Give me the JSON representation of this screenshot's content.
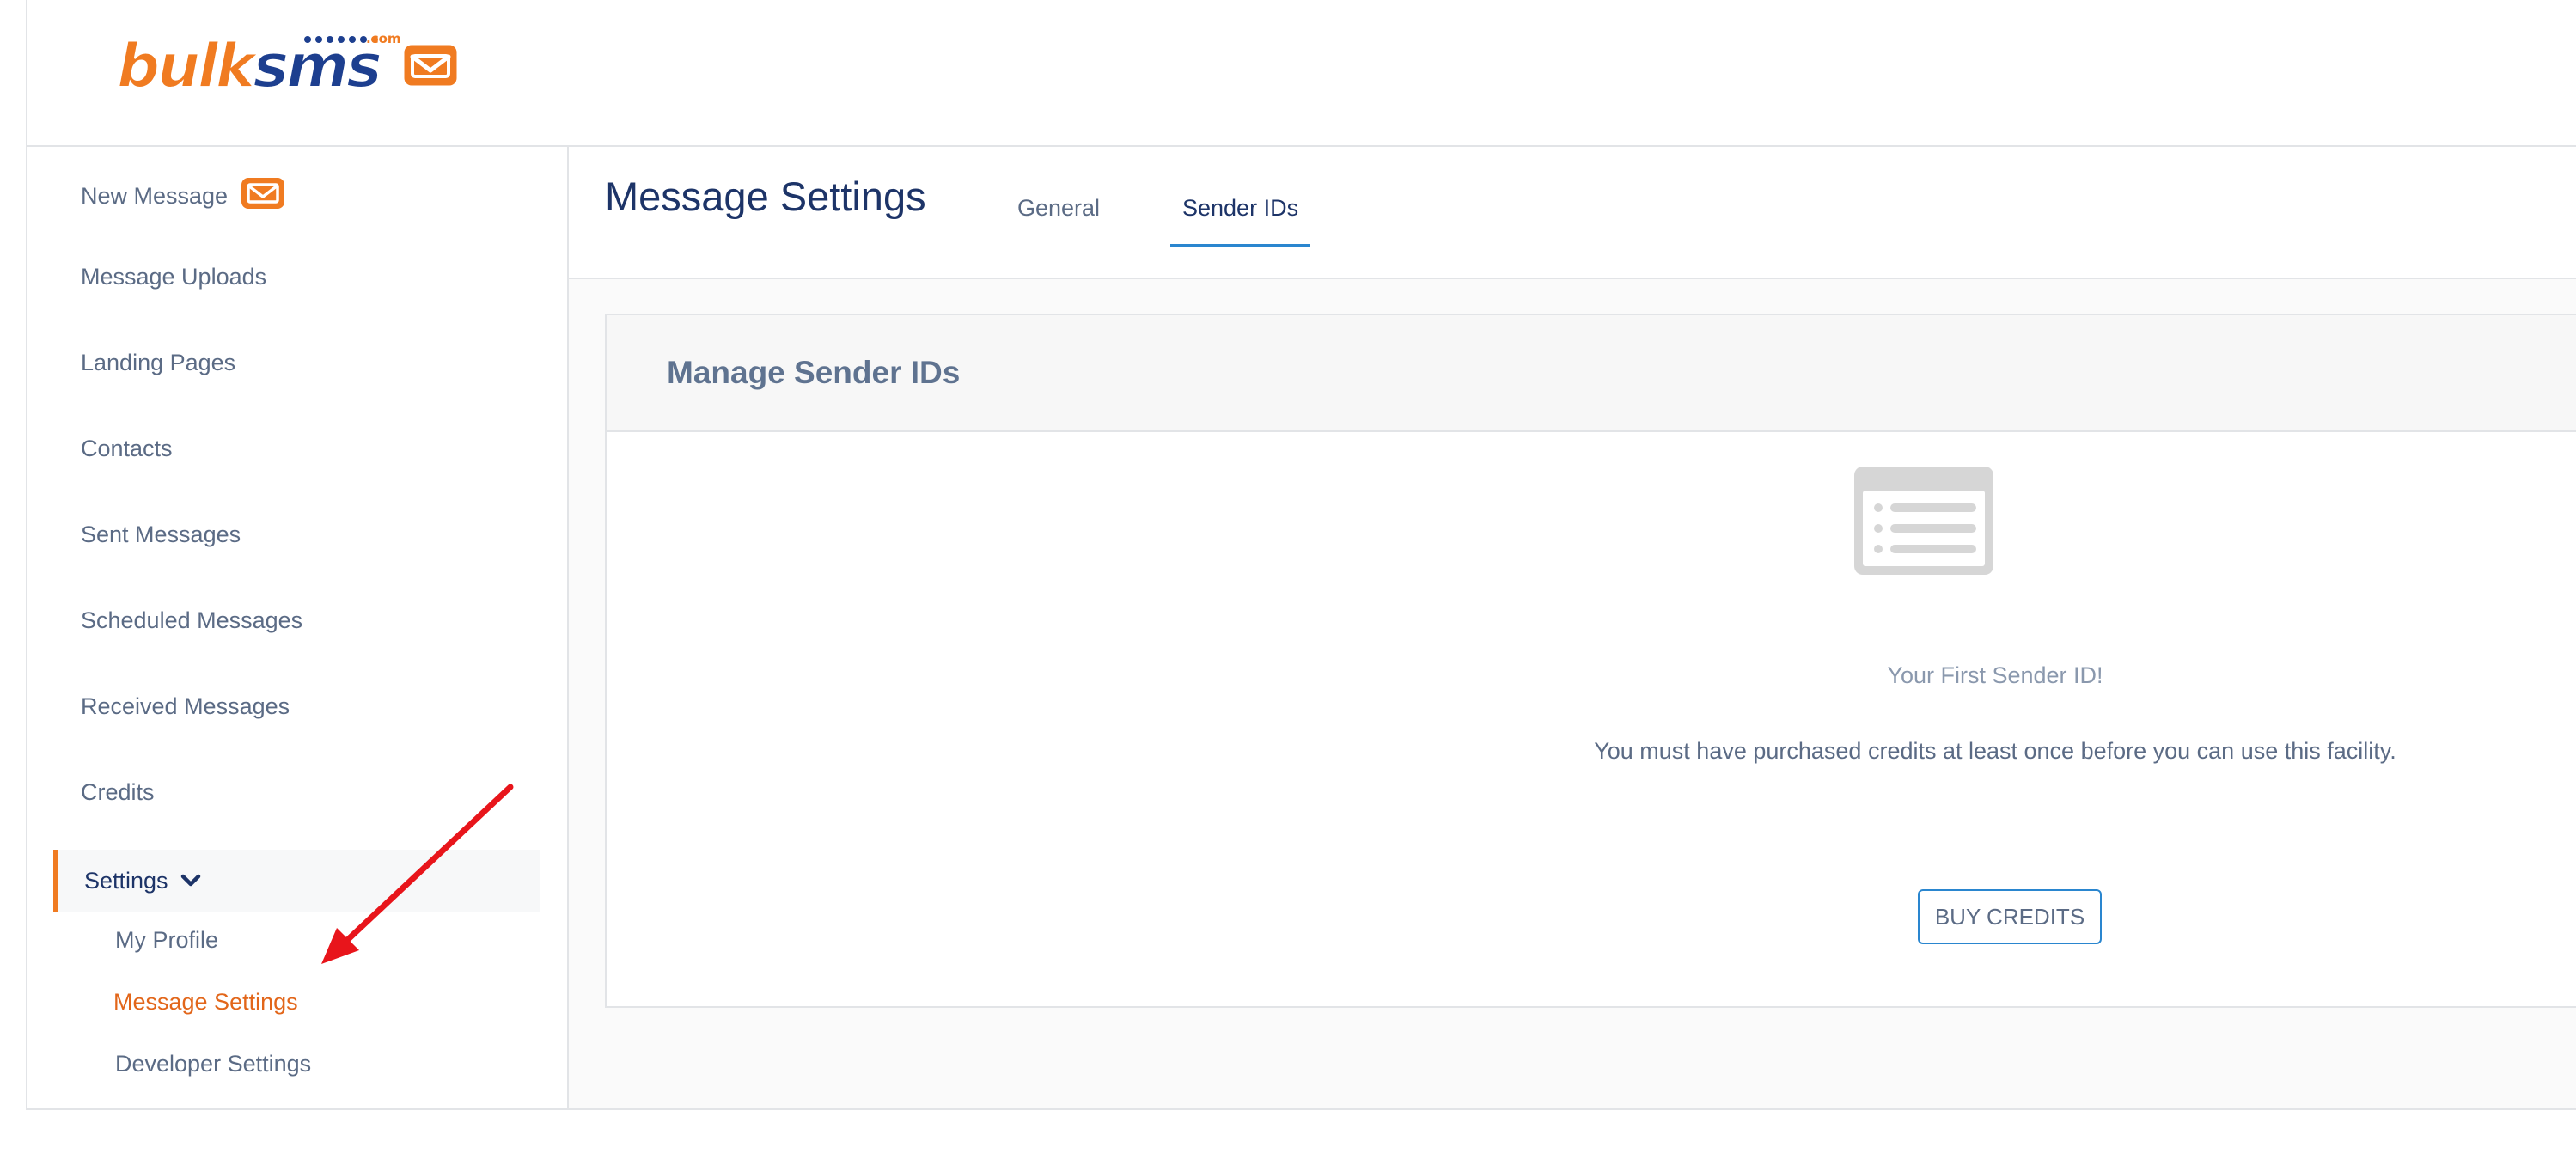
{
  "brand": {
    "logo_text_part1": "bulk",
    "logo_text_part2": "sms",
    "logo_domain": ".com",
    "colors": {
      "orange": "#f07b21",
      "navy": "#1d3f8f"
    }
  },
  "sidebar": {
    "items": [
      {
        "label": "New Message",
        "icon": "envelope-icon"
      },
      {
        "label": "Message Uploads"
      },
      {
        "label": "Landing Pages"
      },
      {
        "label": "Contacts"
      },
      {
        "label": "Sent Messages"
      },
      {
        "label": "Scheduled Messages"
      },
      {
        "label": "Received Messages"
      },
      {
        "label": "Credits"
      }
    ],
    "settings": {
      "label": "Settings",
      "icon": "chevron-down-icon",
      "children": [
        {
          "label": "My Profile"
        },
        {
          "label": "Message Settings",
          "active": true
        },
        {
          "label": "Developer Settings"
        }
      ]
    }
  },
  "header": {
    "title": "Message Settings",
    "tabs": [
      {
        "label": "General",
        "active": false
      },
      {
        "label": "Sender IDs",
        "active": true
      }
    ]
  },
  "card": {
    "title": "Manage Sender IDs",
    "empty_icon": "list-icon",
    "empty_title": "Your First Sender ID!",
    "empty_description": "You must have purchased credits at least once before you can use this facility.",
    "button_label": "BUY CREDITS"
  },
  "annotation": {
    "icon": "red-arrow-icon",
    "color": "#e8151b"
  }
}
